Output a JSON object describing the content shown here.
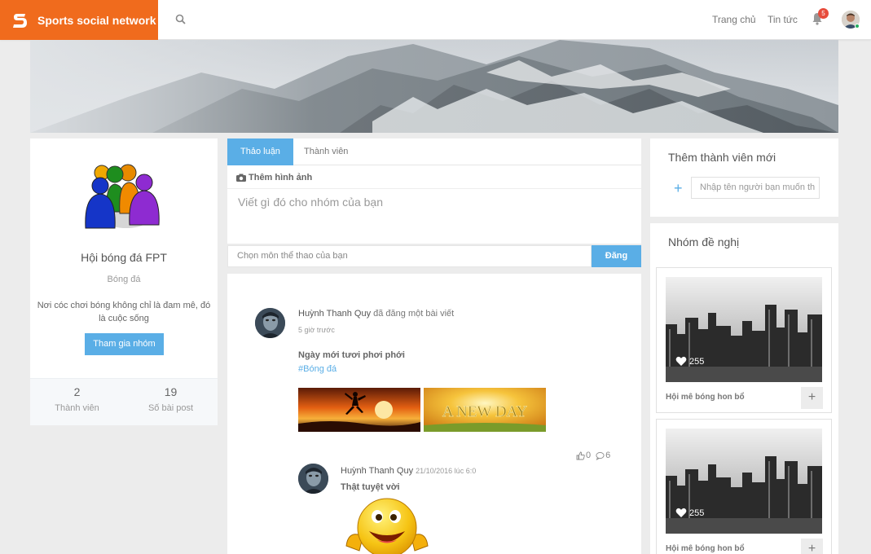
{
  "header": {
    "brand": "Sports social network",
    "nav": {
      "home": "Trang chủ",
      "news": "Tin tức"
    },
    "notifications_count": "5",
    "colors": {
      "brand": "#f06b1d",
      "accent": "#5aaee6"
    }
  },
  "group": {
    "name": "Hội bóng đá FPT",
    "category": "Bóng đá",
    "description": "Nơi cóc chơi bóng không chỉ là đam mê, đó là cuộc sống",
    "join_label": "Tham gia nhóm",
    "members_count": "2",
    "members_label": "Thành viên",
    "posts_count": "19",
    "posts_label": "Số bài post"
  },
  "composer": {
    "tabs": [
      {
        "label": "Thảo luận"
      },
      {
        "label": "Thành viên"
      }
    ],
    "add_photo": "Thêm hình ảnh",
    "placeholder": "Viết gì đó cho nhóm của bạn",
    "sport_placeholder": "Chọn môn thể thao của bạn",
    "post_button": "Đăng"
  },
  "post": {
    "author": "Huỳnh Thanh Quy",
    "action": "đã đăng một bài viết",
    "time": "5 giờ trước",
    "text": "Ngày mới tươi phơi phới",
    "tag": "#Bóng đá",
    "image2_text": "A NEW DAY",
    "likes": "0",
    "comments": "6",
    "comment": {
      "author": "Huỳnh Thanh Quy",
      "time": "21/10/2016 lúc 6:0",
      "text": "Thật tuyệt vời"
    }
  },
  "invite": {
    "title": "Thêm thành viên mới",
    "plus": "+",
    "placeholder": "Nhập tên người bạn muốn th"
  },
  "suggestions": {
    "title": "Nhóm đề nghị",
    "items": [
      {
        "name": "Hội mê bóng hon bổ",
        "likes": "255"
      },
      {
        "name": "Hội mê bóng hon bổ",
        "likes": "255"
      }
    ]
  }
}
